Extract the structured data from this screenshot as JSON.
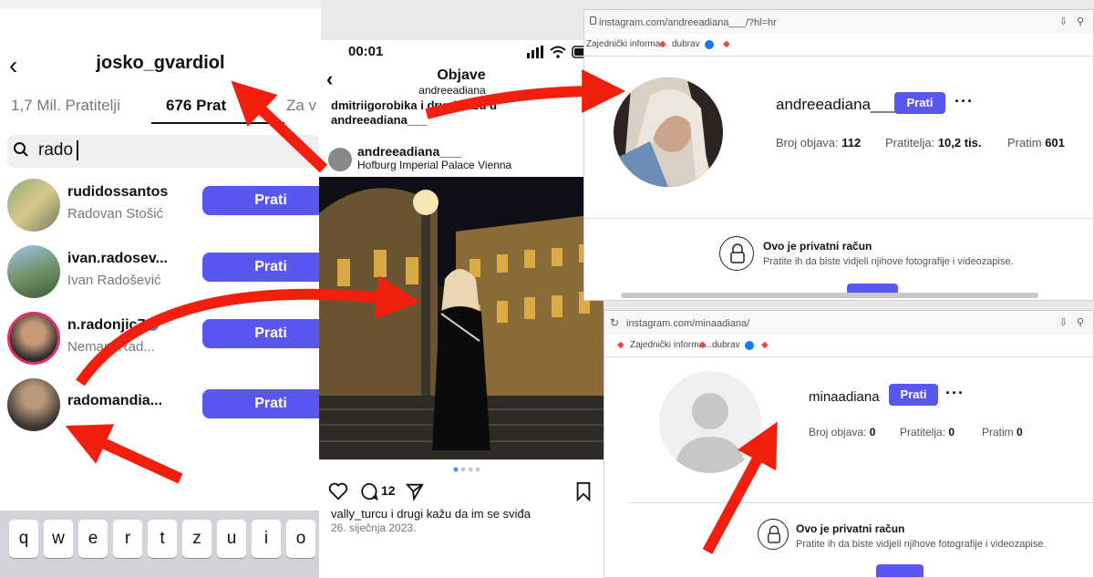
{
  "followers_panel": {
    "username": "josko_gvardiol",
    "tabs": [
      "1,7 Mil. Pratitelji",
      "676 Prat",
      "Za v"
    ],
    "search": {
      "value": "rado"
    },
    "rows": [
      {
        "username": "rudidossantos",
        "fullname": "Radovan Stošić",
        "button": "Prati"
      },
      {
        "username": "ivan.radosev...",
        "fullname": "Ivan Radošević",
        "button": "Prati"
      },
      {
        "username": "n.radonjic7",
        "fullname": "Nemanj Rad...",
        "button": "Prati"
      },
      {
        "username": "radomandia...",
        "fullname": "",
        "button": "Prati"
      }
    ],
    "keyboard": [
      "q",
      "w",
      "e",
      "r",
      "t",
      "z",
      "u",
      "i",
      "o"
    ]
  },
  "post_panel": {
    "time": "00:01",
    "title": "Objave",
    "subtitle": "andreeadiana___",
    "caption_line1": "dmitriigorobika i drugi kažu d",
    "caption_line2": "andreeadiana___",
    "post_user": "andreeadiana___",
    "location": "Hofburg Imperial Palace Vienna",
    "comment_count": "12",
    "likes_text": "vally_turcu i drugi kažu da im se sviđa",
    "date": "26. siječnja 2023."
  },
  "browser1": {
    "url": "instagram.com/andreeadiana___/?hl=hr",
    "bookmarks": [
      "Zajednički informa...",
      "dubrav"
    ],
    "username": "andreeadiana___",
    "button": "Prati",
    "stats": [
      {
        "label": "Broj objava:",
        "value": "112"
      },
      {
        "label": "Pratitelja:",
        "value": "10,2 tis."
      },
      {
        "label": "Pratim",
        "value": "601"
      }
    ],
    "private_title": "Ovo je privatni račun",
    "private_sub": "Pratite ih da biste vidjeli njihove fotografije i videozapise."
  },
  "browser2": {
    "url": "instagram.com/minaadiana/",
    "bookmarks": [
      "Zajednički informa...",
      "dubrav"
    ],
    "username": "minaadiana",
    "button": "Prati",
    "stats": [
      {
        "label": "Broj objava:",
        "value": "0"
      },
      {
        "label": "Pratitelja:",
        "value": "0"
      },
      {
        "label": "Pratim",
        "value": "0"
      }
    ],
    "private_title": "Ovo je privatni račun",
    "private_sub": "Pratite ih da biste vidjeli njihove fotografije i videozapise."
  },
  "colors": {
    "accent": "#5a57f0",
    "arrow": "#f21f0f",
    "ring": "#e1306c"
  }
}
